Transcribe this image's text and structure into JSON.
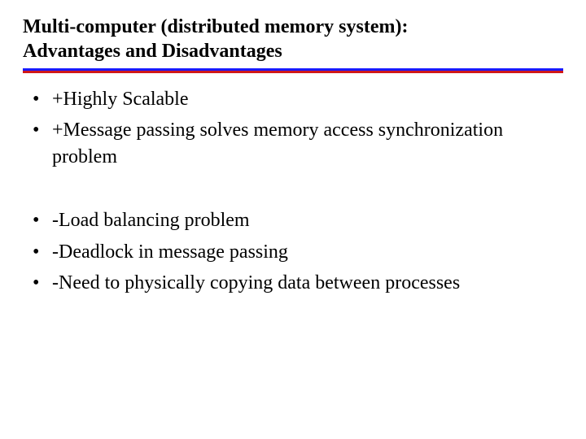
{
  "title_line1": "Multi-computer (distributed memory system):",
  "title_line2": "Advantages and Disadvantages",
  "advantages": [
    "+Highly Scalable",
    "+Message passing solves memory access synchronization problem"
  ],
  "disadvantages": [
    "-Load balancing problem",
    "-Deadlock in message passing",
    "-Need to physically copying data between processes"
  ]
}
